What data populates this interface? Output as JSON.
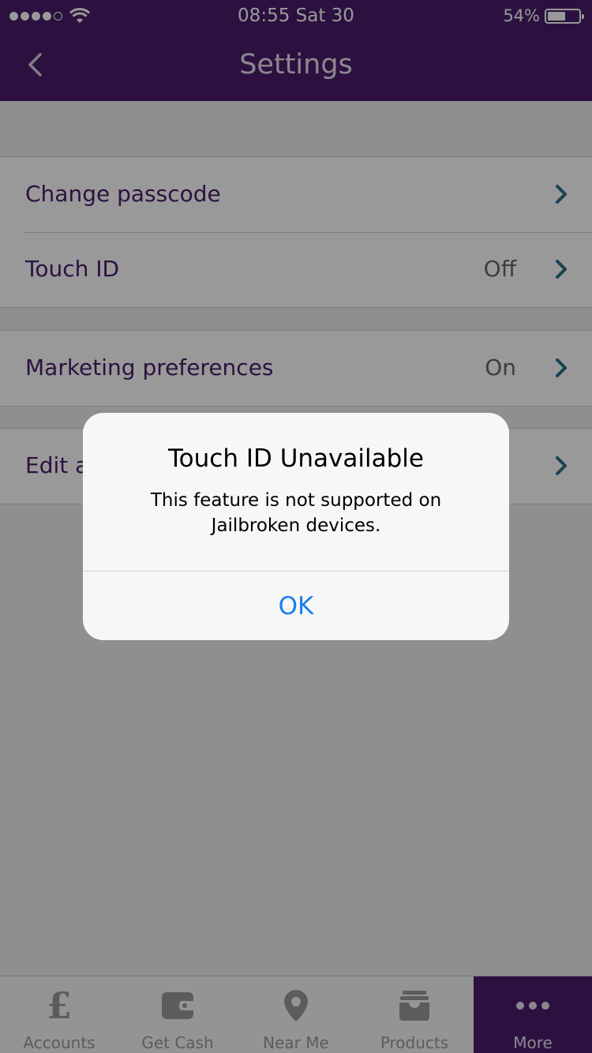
{
  "status_bar": {
    "time": "08:55 Sat 30",
    "battery_percent": "54%",
    "battery_level": 0.54,
    "signal_bars_filled": 4,
    "signal_bars_total": 5
  },
  "navbar": {
    "title": "Settings",
    "back_icon": "chevron-left-icon"
  },
  "settings": {
    "groups": [
      {
        "rows": [
          {
            "label": "Change passcode",
            "value": ""
          },
          {
            "label": "Touch ID",
            "value": "Off"
          }
        ]
      },
      {
        "rows": [
          {
            "label": "Marketing preferences",
            "value": "On"
          }
        ]
      },
      {
        "rows": [
          {
            "label": "Edit a",
            "value": ""
          }
        ]
      }
    ]
  },
  "tabbar": {
    "tabs": [
      {
        "label": "Accounts",
        "icon": "pound-icon",
        "active": false
      },
      {
        "label": "Get Cash",
        "icon": "wallet-icon",
        "active": false
      },
      {
        "label": "Near Me",
        "icon": "map-pin-icon",
        "active": false
      },
      {
        "label": "Products",
        "icon": "archive-icon",
        "active": false
      },
      {
        "label": "More",
        "icon": "more-dots-icon",
        "active": true
      }
    ]
  },
  "alert": {
    "title": "Touch ID Unavailable",
    "message": "This feature is not supported on Jailbroken devices.",
    "ok_label": "OK"
  },
  "colors": {
    "brand_purple": "#4a1d6b",
    "link_blue": "#1a7ff0",
    "chevron_teal": "#2a6f86"
  }
}
